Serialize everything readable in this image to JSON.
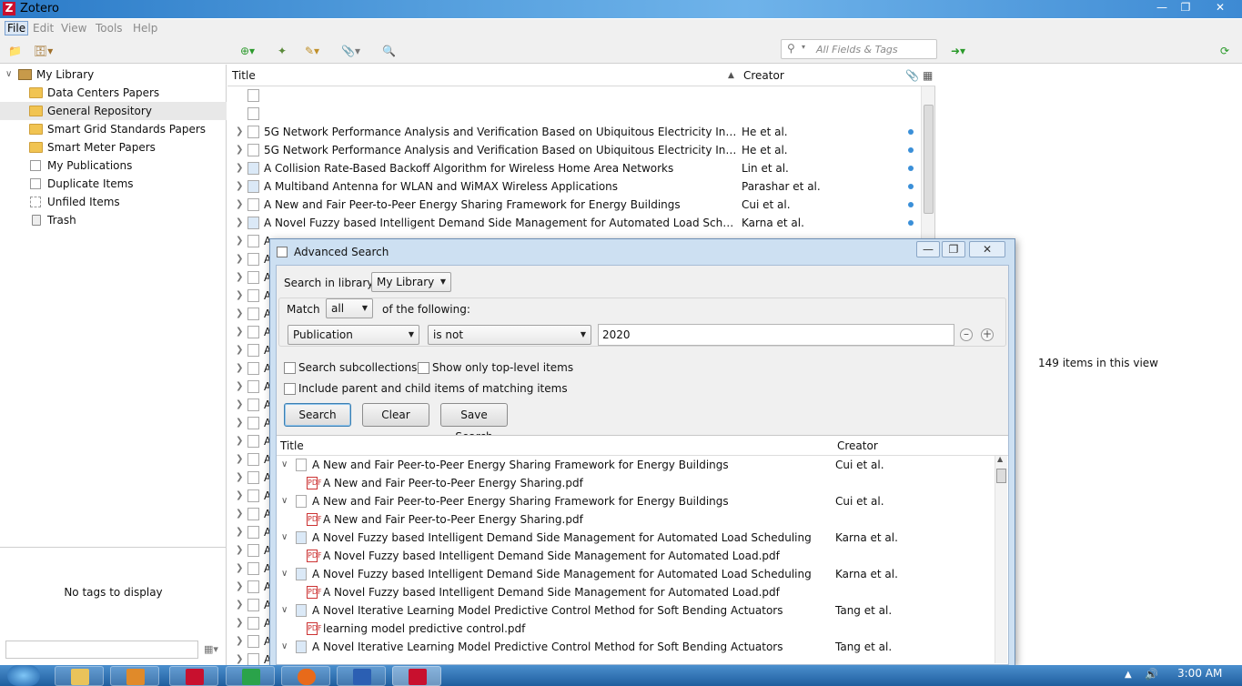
{
  "window": {
    "app_title": "Zotero",
    "logo_letter": "Z"
  },
  "menubar": {
    "file": "File",
    "edit": "Edit",
    "view": "View",
    "tools": "Tools",
    "help": "Help"
  },
  "search": {
    "placeholder": "All Fields & Tags"
  },
  "collections": {
    "library": "My Library",
    "items": [
      "Data Centers Papers",
      "General Repository",
      "Smart Grid Standards Papers",
      "Smart Meter Papers",
      "My Publications",
      "Duplicate Items",
      "Unfiled Items",
      "Trash"
    ],
    "selected": "General Repository"
  },
  "tags": {
    "empty_message": "No tags to display"
  },
  "items_pane": {
    "col_title": "Title",
    "col_creator": "Creator",
    "rows": [
      {
        "title": "",
        "creator": ""
      },
      {
        "title": "",
        "creator": ""
      },
      {
        "title": "5G Network Performance Analysis and Verification Based on Ubiquitous Electricity Internet of Thi...",
        "creator": "He et al."
      },
      {
        "title": "5G Network Performance Analysis and Verification Based on Ubiquitous Electricity Internet of Thi...",
        "creator": "He et al."
      },
      {
        "title": "A Collision Rate-Based Backoff Algorithm for Wireless Home Area Networks",
        "creator": "Lin et al."
      },
      {
        "title": "A Multiband Antenna for WLAN and WiMAX Wireless Applications",
        "creator": "Parashar et al."
      },
      {
        "title": "A New and Fair Peer-to-Peer Energy Sharing Framework for Energy Buildings",
        "creator": "Cui et al."
      },
      {
        "title": "A Novel Fuzzy based Intelligent Demand Side Management for Automated Load Scheduling",
        "creator": "Karna et al."
      }
    ],
    "truncated_letter": "A",
    "item_count": "149 items in this view"
  },
  "dialog": {
    "title": "Advanced Search",
    "search_in_label": "Search in library:",
    "search_in_value": "My Library",
    "match_label": "Match",
    "match_value": "all",
    "of_following": "of the following:",
    "condition_field": "Publication",
    "condition_operator": "is not",
    "condition_value": "2020",
    "search_subcollections": "Search subcollections",
    "show_top_level": "Show only top-level items",
    "include_parent_child": "Include parent and child items of matching items",
    "btn_search": "Search",
    "btn_clear": "Clear",
    "btn_save": "Save Search",
    "results": {
      "col_title": "Title",
      "col_creator": "Creator",
      "rows": [
        {
          "title": "A New and Fair Peer-to-Peer Energy Sharing Framework for Energy Buildings",
          "creator": "Cui et al.",
          "child": "A New and Fair Peer-to-Peer Energy Sharing.pdf"
        },
        {
          "title": "A New and Fair Peer-to-Peer Energy Sharing Framework for Energy Buildings",
          "creator": "Cui et al.",
          "child": "A New and Fair Peer-to-Peer Energy Sharing.pdf"
        },
        {
          "title": "A Novel Fuzzy based Intelligent Demand Side Management for Automated Load Scheduling",
          "creator": "Karna et al.",
          "child": "A Novel Fuzzy based Intelligent Demand Side Management for Automated Load.pdf"
        },
        {
          "title": "A Novel Fuzzy based Intelligent Demand Side Management for Automated Load Scheduling",
          "creator": "Karna et al.",
          "child": "A Novel Fuzzy based Intelligent Demand Side Management for Automated Load.pdf"
        },
        {
          "title": "A Novel Iterative Learning Model Predictive Control Method for Soft Bending Actuators",
          "creator": "Tang et al.",
          "child": "learning model predictive control.pdf"
        },
        {
          "title": "A Novel Iterative Learning Model Predictive Control Method for Soft Bending Actuators",
          "creator": "Tang et al.",
          "child": ""
        }
      ]
    }
  },
  "taskbar": {
    "clock": "3:00 AM"
  },
  "colors": {
    "accent": "#3a8fd8",
    "selection": "#e8e8e8",
    "dialog_frame": "#cde0f2"
  }
}
